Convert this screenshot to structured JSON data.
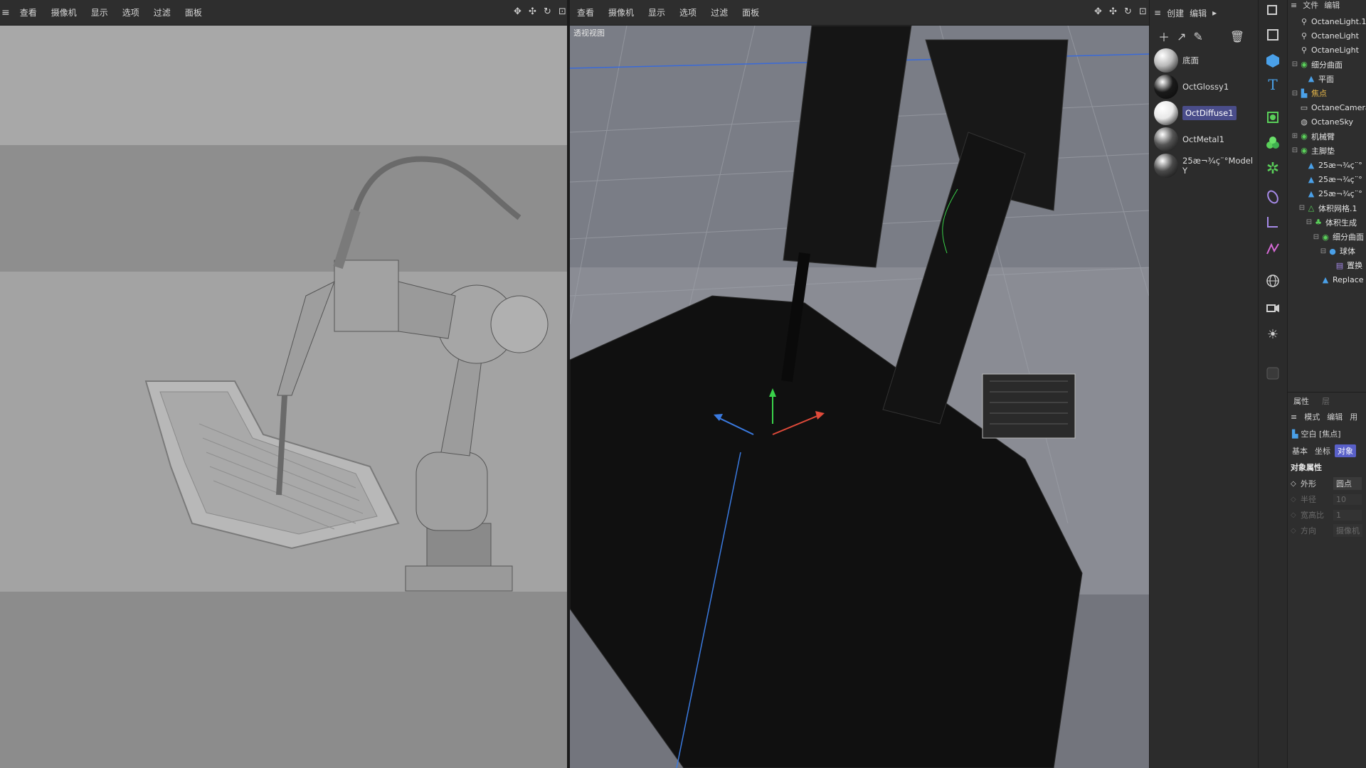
{
  "left_viewport": {
    "menu": [
      "查看",
      "摄像机",
      "显示",
      "选项",
      "过滤",
      "面板"
    ]
  },
  "right_viewport": {
    "menu": [
      "查看",
      "摄像机",
      "显示",
      "选项",
      "过滤",
      "面板"
    ],
    "label": "透视视图"
  },
  "material_panel": {
    "menu": [
      "创建",
      "编辑"
    ],
    "materials": [
      {
        "name": "底面",
        "ball": "#b9b9b9"
      },
      {
        "name": "OctGlossy1",
        "ball": "#1a1a1a"
      },
      {
        "name": "OctDiffuse1",
        "ball": "#e8e8e8",
        "selected": true
      },
      {
        "name": "OctMetal1",
        "ball": "#555555"
      },
      {
        "name": "25æ¬¾ç¨°Model Y",
        "ball": "#4a4a4a"
      }
    ]
  },
  "object_manager": {
    "menu": [
      "文件",
      "编辑"
    ],
    "rows": [
      {
        "label": "OctaneLight.1",
        "indent": 0,
        "icon": "light-icon",
        "toggle": ""
      },
      {
        "label": "OctaneLight",
        "indent": 0,
        "icon": "light-icon",
        "toggle": ""
      },
      {
        "label": "OctaneLight",
        "indent": 0,
        "icon": "light-icon",
        "toggle": ""
      },
      {
        "label": "细分曲面",
        "indent": 0,
        "icon": "subdivision-icon",
        "toggle": "⊟"
      },
      {
        "label": "平面",
        "indent": 1,
        "icon": "plane-icon",
        "toggle": ""
      },
      {
        "label": "焦点",
        "indent": 0,
        "icon": "null-icon",
        "toggle": "⊟",
        "highlight": true
      },
      {
        "label": "OctaneCamera",
        "indent": 0,
        "icon": "camera-icon",
        "toggle": ""
      },
      {
        "label": "OctaneSky",
        "indent": 0,
        "icon": "sky-icon",
        "toggle": ""
      },
      {
        "label": "机械臂",
        "indent": 0,
        "icon": "group-icon",
        "toggle": "⊞"
      },
      {
        "label": "主脚垫",
        "indent": 0,
        "icon": "group-icon",
        "toggle": "⊟"
      },
      {
        "label": "25æ¬¾ç¨°",
        "indent": 1,
        "icon": "mesh-icon",
        "toggle": ""
      },
      {
        "label": "25æ¬¾ç¨°",
        "indent": 1,
        "icon": "mesh-icon",
        "toggle": ""
      },
      {
        "label": "25æ¬¾ç¨°",
        "indent": 1,
        "icon": "mesh-icon",
        "toggle": ""
      },
      {
        "label": "体积网格.1",
        "indent": 1,
        "icon": "volume-icon",
        "toggle": "⊟"
      },
      {
        "label": "体积生成",
        "indent": 2,
        "icon": "volume-gen-icon",
        "toggle": "⊟"
      },
      {
        "label": "细分曲面",
        "indent": 3,
        "icon": "subdivision-icon",
        "toggle": "⊟"
      },
      {
        "label": "球体",
        "indent": 4,
        "icon": "sphere-icon",
        "toggle": "⊟"
      },
      {
        "label": "置换",
        "indent": 5,
        "icon": "displace-icon",
        "toggle": ""
      },
      {
        "label": "Replace",
        "indent": 3,
        "icon": "mesh-icon",
        "toggle": ""
      }
    ]
  },
  "attributes": {
    "tabs_top": [
      "属性",
      "层"
    ],
    "menu": [
      "模式",
      "编辑",
      "用"
    ],
    "object_name": "空白 [焦点]",
    "tabs": [
      "基本",
      "坐标",
      "对象"
    ],
    "active_tab": "对象",
    "section": "对象属性",
    "fields": [
      {
        "label": "外形",
        "value": "圆点",
        "enabled": true
      },
      {
        "label": "半径",
        "value": "10",
        "enabled": false
      },
      {
        "label": "宽高比",
        "value": "1",
        "enabled": false
      },
      {
        "label": "方向",
        "value": "摄像机",
        "enabled": false
      }
    ]
  },
  "colors": {
    "accent": "#5960c8",
    "axis_x": "#e04a3a",
    "axis_y": "#3ad24a",
    "axis_z": "#3a7ae0"
  }
}
